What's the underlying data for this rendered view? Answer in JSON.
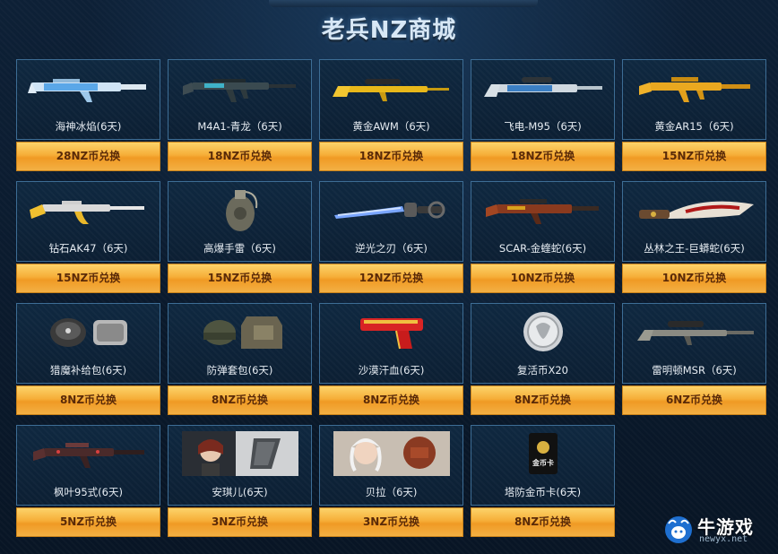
{
  "page": {
    "title": "老兵NZ商城"
  },
  "items": [
    {
      "name": "海神冰焰(6天)",
      "price": "28NZ币兑换",
      "icon": "rifle-ice-icon"
    },
    {
      "name": "M4A1-青龙（6天)",
      "price": "18NZ币兑换",
      "icon": "rifle-dragon-icon"
    },
    {
      "name": "黄金AWM（6天)",
      "price": "18NZ币兑换",
      "icon": "sniper-gold-icon"
    },
    {
      "name": "飞电-M95（6天)",
      "price": "18NZ币兑换",
      "icon": "sniper-blue-icon"
    },
    {
      "name": "黄金AR15（6天)",
      "price": "15NZ币兑换",
      "icon": "rifle-gold-icon"
    },
    {
      "name": "钻石AK47（6天)",
      "price": "15NZ币兑换",
      "icon": "ak47-gold-icon"
    },
    {
      "name": "高爆手雷（6天)",
      "price": "15NZ币兑换",
      "icon": "grenade-icon"
    },
    {
      "name": "逆光之刃（6天)",
      "price": "12NZ币兑换",
      "icon": "blade-icon"
    },
    {
      "name": "SCAR-金蝰蛇(6天)",
      "price": "10NZ币兑换",
      "icon": "scar-icon"
    },
    {
      "name": "丛林之王-巨蟒蛇(6天)",
      "price": "10NZ币兑换",
      "icon": "jungle-knife-icon"
    },
    {
      "name": "猎魔补给包(6天)",
      "price": "8NZ币兑换",
      "icon": "supply-pack-icon"
    },
    {
      "name": "防弹套包(6天)",
      "price": "8NZ币兑换",
      "icon": "armor-set-icon"
    },
    {
      "name": "沙漠汗血(6天)",
      "price": "8NZ币兑换",
      "icon": "desert-eagle-icon"
    },
    {
      "name": "复活币X20",
      "price": "8NZ币兑换",
      "icon": "revive-coin-icon"
    },
    {
      "name": "雷明顿MSR（6天)",
      "price": "6NZ币兑换",
      "icon": "msr-sniper-icon"
    },
    {
      "name": "枫叶95式(6天)",
      "price": "5NZ币兑换",
      "icon": "type95-rifle-icon"
    },
    {
      "name": "安琪儿(6天)",
      "price": "3NZ币兑换",
      "icon": "angel-character-icon"
    },
    {
      "name": "贝拉（6天)",
      "price": "3NZ币兑换",
      "icon": "bella-character-icon"
    },
    {
      "name": "塔防金币卡(6天)",
      "price": "8NZ币兑换",
      "icon": "gold-coin-card-icon"
    }
  ],
  "coin_card_label": "金币卡",
  "watermark": {
    "text": "牛游戏",
    "url": "newyx.net"
  }
}
